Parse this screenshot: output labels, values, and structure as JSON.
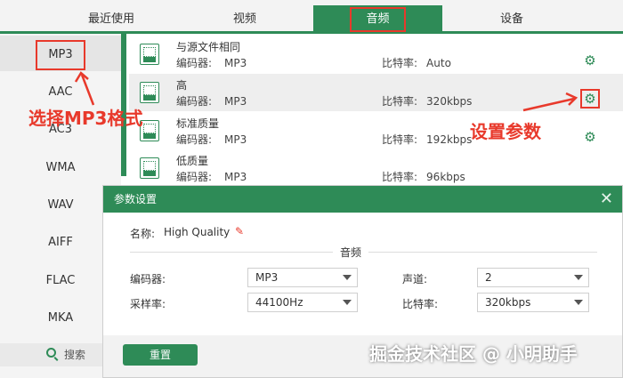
{
  "tabs": [
    {
      "label": "最近使用"
    },
    {
      "label": "视频"
    },
    {
      "label": "音频"
    },
    {
      "label": "设备"
    }
  ],
  "sidebar": {
    "formats": [
      "MP3",
      "AAC",
      "AC3",
      "WMA",
      "WAV",
      "AIFF",
      "FLAC",
      "MKA"
    ],
    "selected": "MP3",
    "search_label": "搜索"
  },
  "qualities": [
    {
      "name": "与源文件相同",
      "encoder_label": "编码器:",
      "encoder": "MP3",
      "bitrate_label": "比特率:",
      "bitrate": "Auto"
    },
    {
      "name": "高",
      "encoder_label": "编码器:",
      "encoder": "MP3",
      "bitrate_label": "比特率:",
      "bitrate": "320kbps"
    },
    {
      "name": "标准质量",
      "encoder_label": "编码器:",
      "encoder": "MP3",
      "bitrate_label": "比特率:",
      "bitrate": "192kbps"
    },
    {
      "name": "低质量",
      "encoder_label": "编码器:",
      "encoder": "MP3",
      "bitrate_label": "比特率:",
      "bitrate": "96kbps"
    }
  ],
  "annotations": {
    "select_format": "选择MP3格式",
    "set_params": "设置参数"
  },
  "dialog": {
    "title": "参数设置",
    "name_label": "名称:",
    "name_value": "High Quality",
    "section_title": "音频",
    "encoder_label": "编码器:",
    "encoder_value": "MP3",
    "channel_label": "声道:",
    "channel_value": "2",
    "samplerate_label": "采样率:",
    "samplerate_value": "44100Hz",
    "bitrate_label": "比特率:",
    "bitrate_value": "320kbps",
    "reset_label": "重置"
  },
  "watermark": "掘金技术社区 @ 小明助手",
  "colors": {
    "accent": "#2e8b57",
    "annotation": "#e8392b"
  }
}
